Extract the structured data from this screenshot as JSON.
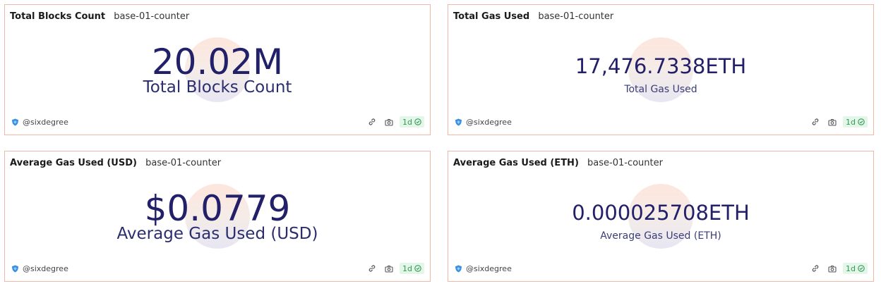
{
  "cards": [
    {
      "title": "Total Blocks Count",
      "subtitle": "base-01-counter",
      "value": "20.02M",
      "label": "Total Blocks Count",
      "author": "@sixdegree",
      "badge": "1d"
    },
    {
      "title": "Total Gas Used",
      "subtitle": "base-01-counter",
      "value": "17,476.7338ETH",
      "label": "Total Gas Used",
      "author": "@sixdegree",
      "badge": "1d"
    },
    {
      "title": "Average Gas Used (USD)",
      "subtitle": "base-01-counter",
      "value": "$0.0779",
      "label": "Average Gas Used (USD)",
      "author": "@sixdegree",
      "badge": "1d"
    },
    {
      "title": "Average Gas Used (ETH)",
      "subtitle": "base-01-counter",
      "value": "0.000025708ETH",
      "label": "Average Gas Used (ETH)",
      "author": "@sixdegree",
      "badge": "1d"
    }
  ],
  "icons": {
    "author": "shield-avatar-icon",
    "embed": "link-icon",
    "snapshot": "camera-icon",
    "refresh_status": "check-circle-icon"
  },
  "colors": {
    "border": "#f0b8a8",
    "value_text": "#23206a",
    "badge_bg": "#e3f6e8",
    "badge_text": "#2f9a57"
  }
}
